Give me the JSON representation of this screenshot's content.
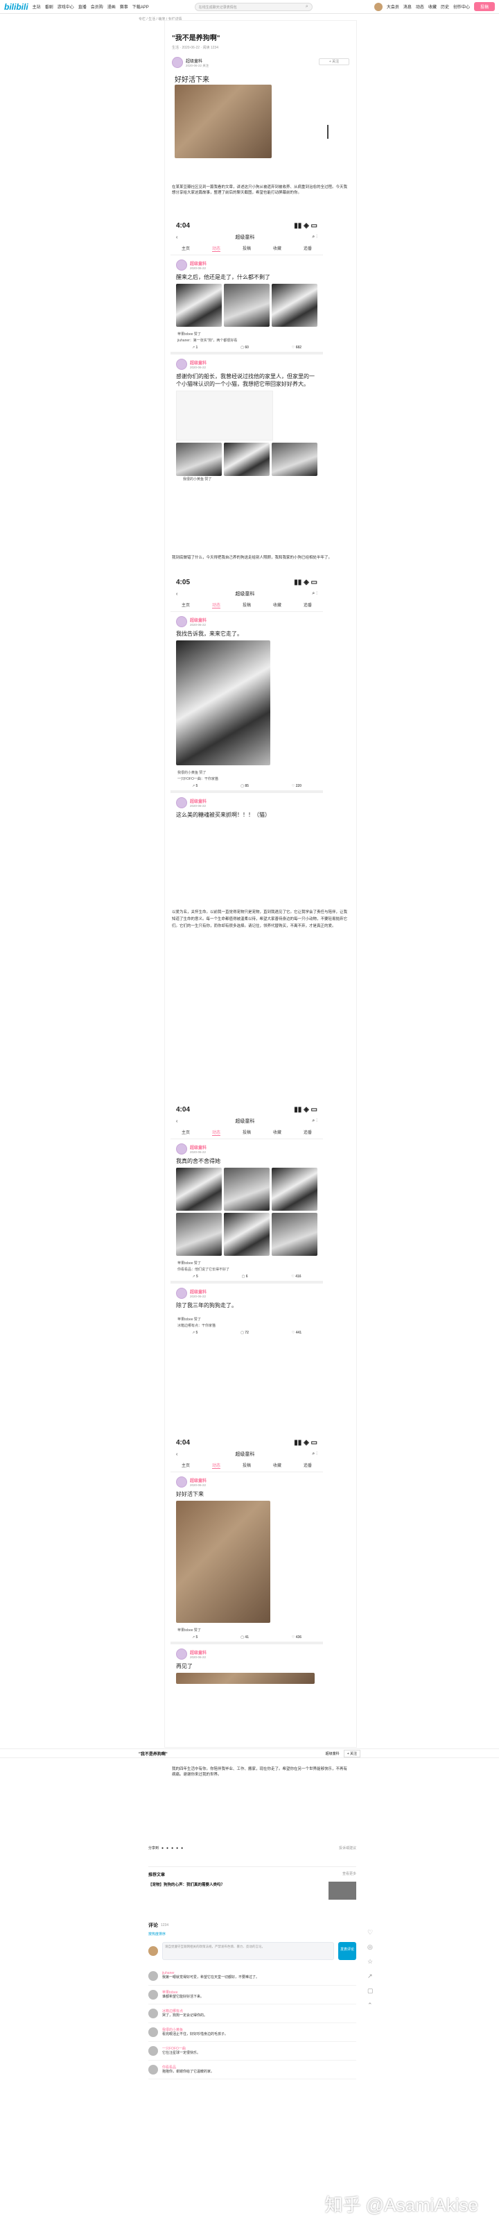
{
  "top": {
    "logo": "bilibili",
    "nav": [
      "主站",
      "番剧",
      "游戏中心",
      "直播",
      "会员购",
      "漫画",
      "赛事",
      "下载APP"
    ],
    "search_placeholder": "在线生成聊天记录表情包",
    "right": [
      "大会员",
      "消息",
      "动态",
      "收藏",
      "历史",
      "创作中心"
    ],
    "upload": "投稿"
  },
  "crumb": "专栏 / 生活 / 萌宠 / 专栏详情",
  "article": {
    "title": "\"我不是养狗啊\"",
    "meta": "生活 · 2020-06-22 · 阅读 1234",
    "author": "超级童科",
    "author_sub": "2020-06-22 关注",
    "follow": "+ 关注",
    "hero_text": "好好活下来"
  },
  "intro": "在某某豆瓣社区见到一篇我看的文章，讲述这只小狗从被遗弃到被收养、从病重到治愈的全过程。今天我想分享给大家这篇故事，整理了前后的聊天截图，希望也能打动屏幕前的你。",
  "phone1": {
    "time": "4:04",
    "title": "超级童科",
    "tabs": [
      "主页",
      "动态",
      "投稿",
      "收藏",
      "追番"
    ],
    "post": {
      "user": "超级童科",
      "date": "2020-06-22",
      "text": "醒来之后，他还是走了，什么都不剩了",
      "c1": "苹果tobee 赞了",
      "c2": "jiuhaner：第一张实\"狗\"，两个都很好看",
      "like": "1",
      "share": "60",
      "comment": "682"
    }
  },
  "post2": {
    "user": "超级童科",
    "date": "2020-06-22",
    "text": "感谢你们的船长，我曾经说过找他的家里人，但家里的一个小猫咪认识的一个小猫，我想把它带回家好好养大。",
    "c1": "我很的小黄鱼 赞了"
  },
  "mid_text": "我到底做错了什么，今天得把我自己养的狗送走给别人照顾，我和我家的小狗已经相处半年了。",
  "phone2": {
    "time": "4:05",
    "title": "超级童科",
    "post": {
      "user": "超级童科",
      "date": "2020-06-22",
      "text": "我找告诉我，来来它走了。",
      "c1": "我很的小黄鱼 赞了",
      "c2": "一只FOFO一曲：干你家猫",
      "like": "5",
      "comment": "85",
      "share": "220"
    }
  },
  "post4": {
    "user": "超级童科",
    "date": "2020-06-22",
    "text": "这么美的糖魂被买来抓啊！！！（猫）"
  },
  "long_text": "以爱为名，关怀生命。以前我一直觉得宠物只是宠物，直到我遇见了它。它让我学会了责任与陪伴，让我知道了生命的意义。每一个生命都值得被温柔以待，希望大家善待身边的每一只小动物，不要轻易抛弃它们。它们的一生只有你，而你却有很多选择。请记住，领养代替购买，不离不弃，才是真正的爱。",
  "phone3": {
    "time": "4:04",
    "title": "超级童科",
    "post": {
      "user": "超级童科",
      "date": "2020-06-22",
      "text": "我真的舍不舍得她",
      "c1": "苹果tobee 赞了",
      "c2": "你看看品：他们说了它长得不好了",
      "like": "5",
      "comment": "6",
      "share": "416"
    },
    "post2": {
      "user": "超级童科",
      "date": "2020-06-22",
      "text": "除了我三年的狗狗走了。",
      "c1": "苹果tobee 赞了",
      "c2": "冰箱边哪有点：干你家猫",
      "like": "5",
      "comment": "72",
      "share": "441"
    }
  },
  "phone4": {
    "time": "4:04",
    "title": "超级童科",
    "post": {
      "user": "超级童科",
      "date": "2020-06-22",
      "text": "好好活下来",
      "c1": "苹果tobee 赞了",
      "like": "5",
      "comment": "41",
      "share": "436"
    },
    "post2": {
      "user": "超级童科",
      "date": "2020-06-22",
      "text": "再见了"
    }
  },
  "sticky": {
    "title": "\"我不是养狗啊\"",
    "author": "超级童科",
    "follow": "+ 关注"
  },
  "end_text": "我的四年生活中有你。你陪伴我毕业、工作、搬家，现在你走了。希望你在另一个世界能够快乐，不再有病痛。谢谢你来过我的世界。",
  "share": {
    "label": "分享到",
    "report": "投诉或建议"
  },
  "related": {
    "title": "推荐文章",
    "item": "【宠物】狗狗的心声：我们真的需要人类吗？",
    "more": "查看更多"
  },
  "comments": {
    "title": "评论",
    "count": "1234",
    "sort": "按热度排序",
    "input": "请自觉遵守互联网相关的政策法规，严禁发布色情、暴力、反动的言论。",
    "send": "发表评论",
    "list": [
      {
        "name": "jiuhaner",
        "text": "我第一眼就觉得好可爱，希望它在天堂一切都好，不要难过了。"
      },
      {
        "name": "苹果tobee",
        "text": "谁都希望它能好好活下来。"
      },
      {
        "name": "冰箱边哪有点",
        "text": "哭了，狗狗一定会记得你的。"
      },
      {
        "name": "我很的小黄鱼",
        "text": "看完眼泪止不住，好好珍惜身边的毛孩子。"
      },
      {
        "name": "一只FOFO一曲",
        "text": "它在汪星球一定很快乐。"
      },
      {
        "name": "你看看品",
        "text": "抱抱你，谢谢你给了它温暖的家。"
      }
    ]
  },
  "watermark": "知乎 @AsamiAkise",
  "colors": {
    "accent": "#fb7299",
    "link": "#00a1d6"
  }
}
